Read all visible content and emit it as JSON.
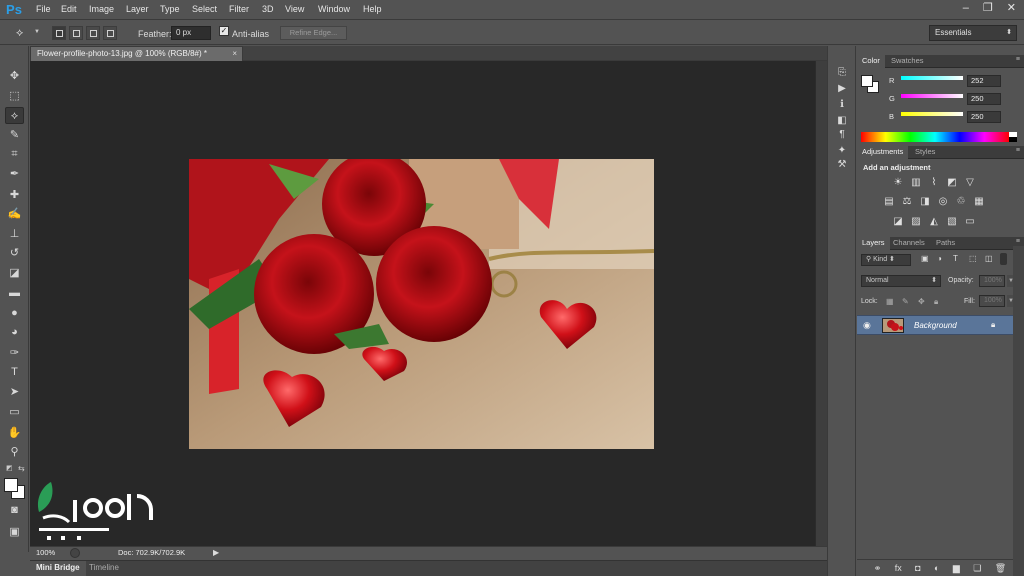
{
  "app": {
    "logo_text": "Ps"
  },
  "menu": [
    "File",
    "Edit",
    "Image",
    "Layer",
    "Type",
    "Select",
    "Filter",
    "3D",
    "View",
    "Window",
    "Help"
  ],
  "window_controls": {
    "minimize": "–",
    "restore": "❐",
    "close": "✕"
  },
  "options_bar": {
    "feather_label": "Feather:",
    "feather_value": "0 px",
    "antialias_label": "Anti-alias",
    "antialias_checked": true,
    "refine_edge_label": "Refine Edge...",
    "workspace": "Essentials"
  },
  "document": {
    "tab_title": "Flower-profile-photo-13.jpg @ 100% (RGB/8#) *",
    "close": "×",
    "zoom": "100%",
    "doc_info": "Doc: 702.9K/702.9K"
  },
  "bottom_tabs": [
    "Mini Bridge",
    "Timeline"
  ],
  "color_panel": {
    "tabs": [
      "Color",
      "Swatches"
    ],
    "r_label": "R",
    "g_label": "G",
    "b_label": "B",
    "r_value": "252",
    "g_value": "250",
    "b_value": "250"
  },
  "adjustments_panel": {
    "tabs": [
      "Adjustments",
      "Styles"
    ],
    "heading": "Add an adjustment"
  },
  "layers_panel": {
    "tabs": [
      "Layers",
      "Channels",
      "Paths"
    ],
    "kind_filter": "Kind",
    "blend_mode": "Normal",
    "opacity_label": "Opacity:",
    "opacity_value": "100%",
    "lock_label": "Lock:",
    "fill_label": "Fill:",
    "fill_value": "100%",
    "layers": [
      {
        "name": "Background",
        "visible": true,
        "locked": true
      }
    ]
  },
  "colors": {
    "chrome": "#535353",
    "canvas_bg": "#282828",
    "selected_layer": "#5a7599",
    "logo_green": "#2a9d56"
  }
}
